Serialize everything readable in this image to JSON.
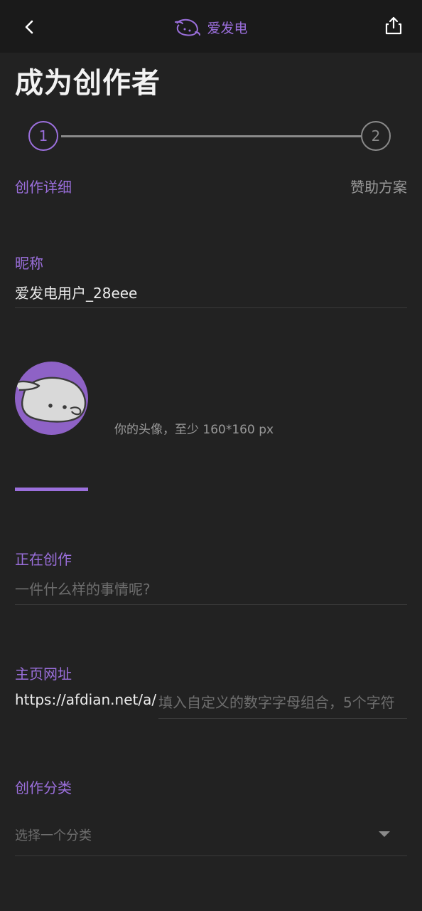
{
  "header": {
    "brand_name": "爱发电"
  },
  "page": {
    "title": "成为创作者"
  },
  "stepper": {
    "steps": [
      {
        "number": "1",
        "label": "创作详细"
      },
      {
        "number": "2",
        "label": "赞助方案"
      }
    ]
  },
  "nickname": {
    "label": "昵称",
    "value": "爱发电用户_28eee"
  },
  "avatar": {
    "hint": "你的头像，至少 160*160 px"
  },
  "creating": {
    "label": "正在创作",
    "placeholder": "一件什么样的事情呢?"
  },
  "homepage": {
    "label": "主页网址",
    "prefix": "https://afdian.net/a/",
    "placeholder": "填入自定义的数字字母组合，5个字符"
  },
  "category": {
    "label": "创作分类",
    "placeholder": "选择一个分类"
  },
  "colors": {
    "accent": "#9b6fdc",
    "background": "#222222",
    "topbar": "#1a1a1a"
  },
  "icons": [
    "back-arrow-icon",
    "brand-logo-icon",
    "share-icon",
    "dropdown-caret-icon"
  ]
}
